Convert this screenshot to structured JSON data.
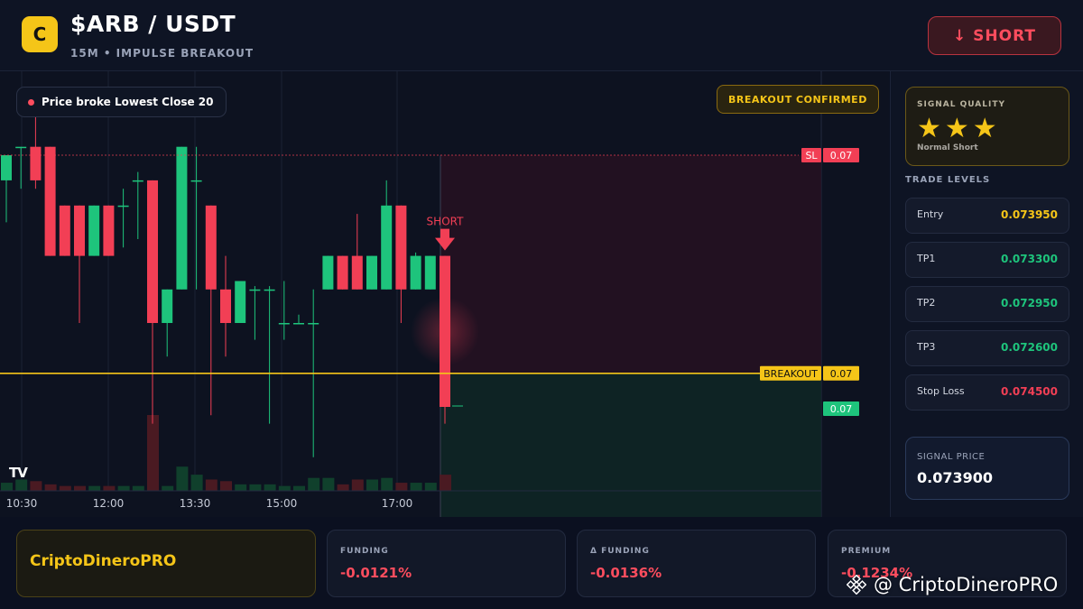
{
  "header": {
    "logo_letter": "C",
    "pair": "$ARB / USDT",
    "subtitle": "15M • IMPULSE BREAKOUT",
    "action_button": "↓ SHORT"
  },
  "chart": {
    "broke_label": "Price broke Lowest Close 20",
    "confirm_label": "BREAKOUT CONFIRMED",
    "short_marker": "SHORT",
    "sl_tag": "SL",
    "sl_value": "0.07",
    "breakout_tag": "BREAKOUT",
    "breakout_value": "0.07",
    "current_value": "0.07",
    "x_ticks": [
      "10:30",
      "12:00",
      "13:30",
      "15:00",
      "17:00"
    ],
    "watermark": "TV",
    "colors": {
      "up": "#1ec47c",
      "down": "#f23f55",
      "breakout": "#f5c518"
    }
  },
  "chart_data": {
    "type": "candlestick",
    "x_ticks": [
      "10:30",
      "12:00",
      "13:30",
      "15:00",
      "17:00"
    ],
    "candles": [
      {
        "o": 0.07425,
        "h": 0.0744,
        "l": 0.074,
        "c": 0.0744
      },
      {
        "o": 0.07445,
        "h": 0.07445,
        "l": 0.0742,
        "c": 0.07445
      },
      {
        "o": 0.07445,
        "h": 0.07465,
        "l": 0.0742,
        "c": 0.07425
      },
      {
        "o": 0.07445,
        "h": 0.07445,
        "l": 0.0738,
        "c": 0.0738
      },
      {
        "o": 0.0741,
        "h": 0.0741,
        "l": 0.0738,
        "c": 0.0738
      },
      {
        "o": 0.0741,
        "h": 0.0741,
        "l": 0.0734,
        "c": 0.0738
      },
      {
        "o": 0.0738,
        "h": 0.0741,
        "l": 0.0738,
        "c": 0.0741
      },
      {
        "o": 0.0741,
        "h": 0.0741,
        "l": 0.0738,
        "c": 0.0738
      },
      {
        "o": 0.0741,
        "h": 0.0742,
        "l": 0.07385,
        "c": 0.0741
      },
      {
        "o": 0.07425,
        "h": 0.0743,
        "l": 0.0739,
        "c": 0.07425
      },
      {
        "o": 0.07425,
        "h": 0.07425,
        "l": 0.0728,
        "c": 0.0734
      },
      {
        "o": 0.0734,
        "h": 0.0736,
        "l": 0.0732,
        "c": 0.0736
      },
      {
        "o": 0.0736,
        "h": 0.07445,
        "l": 0.0736,
        "c": 0.07445
      },
      {
        "o": 0.07425,
        "h": 0.07445,
        "l": 0.0736,
        "c": 0.07425
      },
      {
        "o": 0.0741,
        "h": 0.0741,
        "l": 0.07285,
        "c": 0.0736
      },
      {
        "o": 0.0736,
        "h": 0.0738,
        "l": 0.0732,
        "c": 0.0734
      },
      {
        "o": 0.0734,
        "h": 0.07365,
        "l": 0.0734,
        "c": 0.07365
      },
      {
        "o": 0.0736,
        "h": 0.07362,
        "l": 0.0733,
        "c": 0.0736
      },
      {
        "o": 0.0736,
        "h": 0.07362,
        "l": 0.0728,
        "c": 0.0736
      },
      {
        "o": 0.0734,
        "h": 0.07365,
        "l": 0.0733,
        "c": 0.0734
      },
      {
        "o": 0.0734,
        "h": 0.07345,
        "l": 0.0734,
        "c": 0.0734
      },
      {
        "o": 0.0734,
        "h": 0.0736,
        "l": 0.0726,
        "c": 0.0734
      },
      {
        "o": 0.0736,
        "h": 0.0738,
        "l": 0.0736,
        "c": 0.0738
      },
      {
        "o": 0.0738,
        "h": 0.0738,
        "l": 0.0736,
        "c": 0.0736
      },
      {
        "o": 0.0738,
        "h": 0.07405,
        "l": 0.0736,
        "c": 0.0736
      },
      {
        "o": 0.0736,
        "h": 0.0738,
        "l": 0.0736,
        "c": 0.0738
      },
      {
        "o": 0.0736,
        "h": 0.07425,
        "l": 0.0736,
        "c": 0.0741
      },
      {
        "o": 0.0741,
        "h": 0.0741,
        "l": 0.0734,
        "c": 0.0736
      },
      {
        "o": 0.0736,
        "h": 0.07382,
        "l": 0.0736,
        "c": 0.0738
      },
      {
        "o": 0.0736,
        "h": 0.0738,
        "l": 0.0736,
        "c": 0.0738
      },
      {
        "o": 0.0738,
        "h": 0.0738,
        "l": 0.0728,
        "c": 0.0729
      }
    ],
    "last_price": 0.0729,
    "volume": [
      5,
      7,
      6,
      4,
      3,
      3,
      3,
      3,
      3,
      3,
      47,
      3,
      15,
      10,
      7,
      6,
      4,
      4,
      4,
      3,
      3,
      8,
      8,
      4,
      7,
      7,
      8,
      5,
      5,
      5,
      10
    ],
    "levels": {
      "sl": 0.0744,
      "breakout": 0.0731
    },
    "ylim": [
      0.0724,
      0.0749
    ]
  },
  "sidebar": {
    "quality_title": "SIGNAL QUALITY",
    "stars": "★★★",
    "quality_sub": "Normal Short",
    "levels_title": "TRADE LEVELS",
    "levels": [
      {
        "label": "Entry",
        "value": "0.073950",
        "color": "#f5c518"
      },
      {
        "label": "TP1",
        "value": "0.073300",
        "color": "#1ec47c"
      },
      {
        "label": "TP2",
        "value": "0.072950",
        "color": "#1ec47c"
      },
      {
        "label": "TP3",
        "value": "0.072600",
        "color": "#1ec47c"
      },
      {
        "label": "Stop Loss",
        "value": "0.074500",
        "color": "#f23f55"
      }
    ],
    "signal_price_label": "SIGNAL PRICE",
    "signal_price": "0.073900"
  },
  "footer": {
    "brand": "CriptoDineroPRO",
    "cards": [
      {
        "label": "FUNDING",
        "value": "-0.0121%"
      },
      {
        "label": "Δ FUNDING",
        "value": "-0.0136%"
      },
      {
        "label": "PREMIUM",
        "value": "-0.1234%"
      }
    ],
    "watermark": "@ CriptoDineroPRO"
  }
}
